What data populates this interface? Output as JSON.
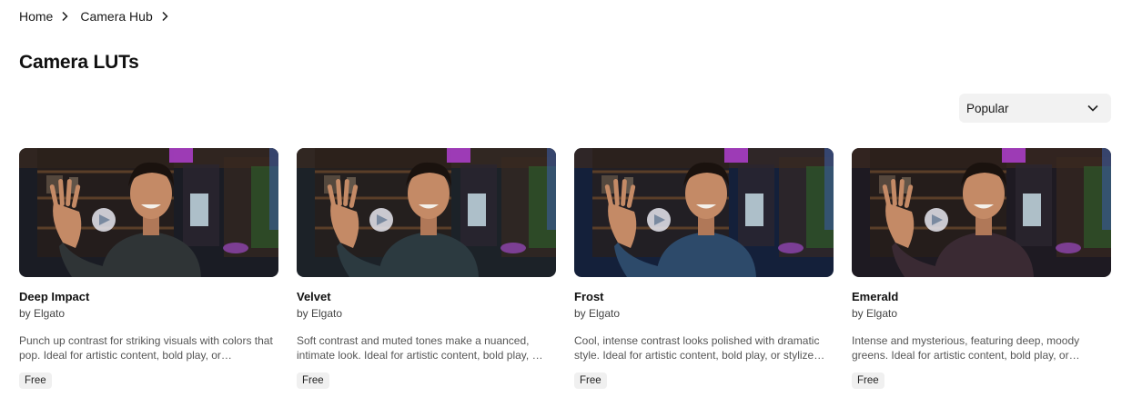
{
  "breadcrumb": [
    {
      "label": "Home"
    },
    {
      "label": "Camera Hub"
    }
  ],
  "page": {
    "title": "Camera LUTs"
  },
  "sort": {
    "selected": "Popular",
    "icon": "chevron-down-icon"
  },
  "cards": [
    {
      "title": "Deep Impact",
      "author": "by Elgato",
      "description": "Punch up contrast for striking visuals with colors that pop. Ideal for artistic content, bold play, or…",
      "badge": "Free",
      "tint": "#2f3436"
    },
    {
      "title": "Velvet",
      "author": "by Elgato",
      "description": "Soft contrast and muted tones make a nuanced, intimate look. Ideal for artistic content, bold play, …",
      "badge": "Free",
      "tint": "#2c3a40"
    },
    {
      "title": "Frost",
      "author": "by Elgato",
      "description": "Cool, intense contrast looks polished with dramatic style. Ideal for artistic content, bold play, or stylize…",
      "badge": "Free",
      "tint": "#2d4a6a"
    },
    {
      "title": "Emerald",
      "author": "by Elgato",
      "description": "Intense and mysterious, featuring deep, moody greens. Ideal for artistic content, bold play, or…",
      "badge": "Free",
      "tint": "#3a2a33"
    }
  ]
}
